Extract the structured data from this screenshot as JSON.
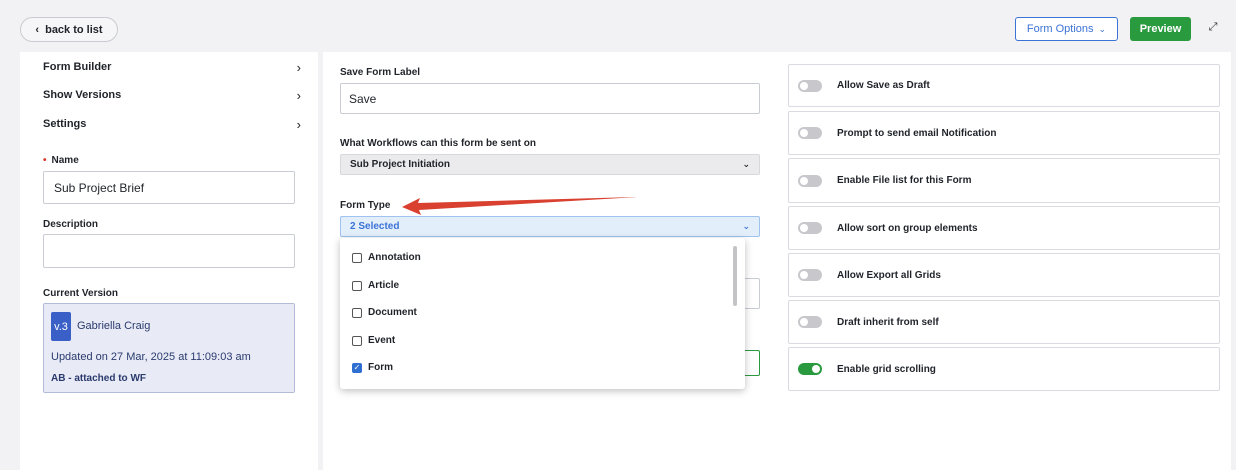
{
  "topbar": {
    "back_label": "back to list",
    "form_options_label": "Form Options",
    "preview_label": "Preview"
  },
  "sidebar": {
    "nav": [
      {
        "label": "Form Builder"
      },
      {
        "label": "Show Versions"
      },
      {
        "label": "Settings"
      }
    ],
    "name_label": "Name",
    "name_value": "Sub Project Brief",
    "description_label": "Description",
    "description_value": "",
    "current_version_label": "Current Version",
    "version": {
      "badge": "v.3",
      "user": "Gabriella Craig",
      "updated": "Updated on 27 Mar, 2025 at 11:09:03 am",
      "attached": "AB - attached to WF"
    }
  },
  "main": {
    "save_label_title": "Save Form Label",
    "save_label_value": "Save",
    "workflows_title": "What Workflows can this form be sent on",
    "workflows_value": "Sub Project Initiation",
    "form_type_title": "Form Type",
    "form_type_value": "2 Selected",
    "form_type_options": [
      {
        "label": "Annotation",
        "checked": false
      },
      {
        "label": "Article",
        "checked": false
      },
      {
        "label": "Document",
        "checked": false
      },
      {
        "label": "Event",
        "checked": false
      },
      {
        "label": "Form",
        "checked": true
      }
    ]
  },
  "settings_toggles": [
    {
      "label": "Allow Save as Draft",
      "on": false
    },
    {
      "label": "Prompt to send email Notification",
      "on": false
    },
    {
      "label": "Enable File list for this Form",
      "on": false
    },
    {
      "label": "Allow sort on group elements",
      "on": false
    },
    {
      "label": "Allow Export all Grids",
      "on": false
    },
    {
      "label": "Draft inherit from self",
      "on": false
    },
    {
      "label": "Enable grid scrolling",
      "on": true
    }
  ],
  "colors": {
    "accent_blue": "#3b73d6",
    "preview_green": "#2a9a3f",
    "arrow_red": "#d9402f"
  }
}
